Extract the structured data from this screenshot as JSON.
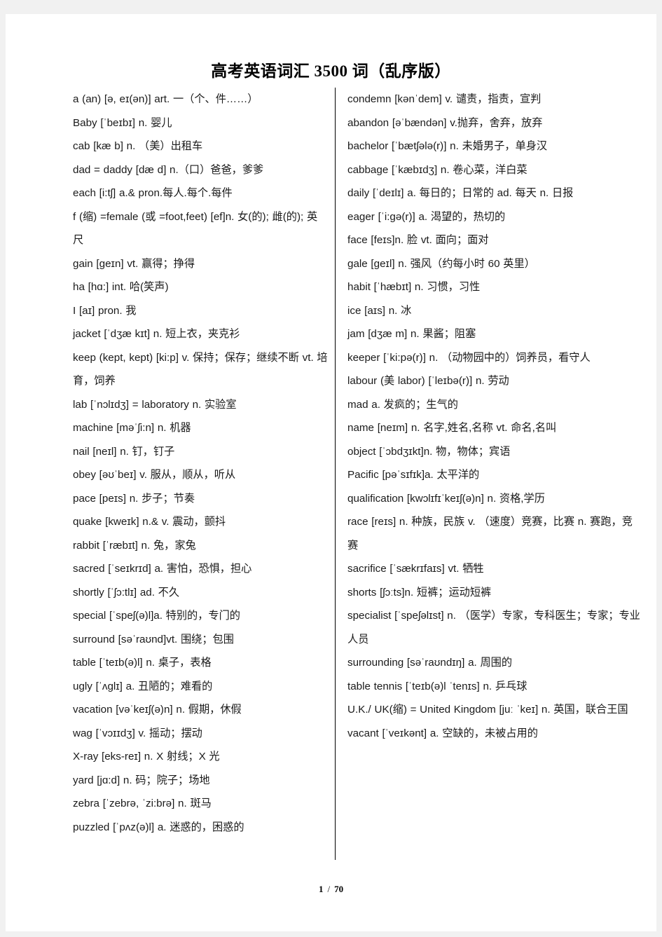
{
  "document": {
    "title": "高考英语词汇 3500 词（乱序版）"
  },
  "footer": {
    "current_page": "1",
    "separator": "/",
    "total_pages": "70"
  },
  "columns": {
    "left": [
      "a (an) [ə, eɪ(ən)] art.  一（个、件……）",
      "Baby [ˈbeɪbɪ] n.  婴儿",
      "cab [kæ b] n. （美）出租车",
      "dad = daddy [dæ d] n.（口）爸爸，爹爹",
      "each [i:tʃ] a.& pron.每人.每个.每件",
      "f (缩) =female (或 =foot,feet) [ef]n.  女(的); 雌(的);  英尺",
      "gain [geɪn] vt.  赢得；挣得",
      "ha [hɑ:] int.  哈(笑声)",
      "I [aɪ] pron.  我",
      "jacket [ˈdʒæ kɪt] n.  短上衣，夹克衫",
      "keep (kept, kept) [ki:p] v.  保持；保存；继续不断 vt.  培育，饲养",
      "lab [ˈnɔlɪdʒ] = laboratory n.  实验室",
      "machine [məˈʃi:n] n.  机器",
      "nail [neɪl] n.  钉，钉子",
      "obey [əʊˈbeɪ] v.  服从，顺从，听从",
      "pace [peɪs] n.  步子；节奏",
      "quake [kweɪk] n.& v.  震动，颤抖",
      "rabbit [ˈræbɪt] n.  兔，家兔",
      "sacred [ˈseɪkrɪd] a.  害怕，恐惧，担心",
      "shortly [ˈʃɔ:tlɪ] ad.  不久",
      "special [ˈspeʃ(ə)l]a.  特别的，专门的",
      "surround [səˈraʊnd]vt.  围绕；包围",
      "table [ˈteɪb(ə)l] n.  桌子，表格",
      "ugly [ˈʌglɪ]   a.  丑陋的；难看的",
      "vacation [vəˈkeɪʃ(ə)n] n.  假期，休假",
      "wag [ˈvɔɪɪdʒ] v.  摇动；摆动",
      "X-ray [eks-reɪ] n. X 射线；X 光",
      "yard [jɑ:d] n.  码；院子；场地",
      "zebra [ˈzebrə, ˈzi:brə] n.  斑马",
      "puzzled [ˈpʌz(ə)l] a.  迷惑的，困惑的"
    ],
    "right": [
      "condemn [kənˈdem] v.  谴责，指责，宣判",
      "abandon [əˈbændən]   v.抛弃，舍弃，放弃",
      "bachelor [ˈbætʃələ(r)] n.  未婚男子，单身汉",
      "cabbage [ˈkæbɪdʒ] n.  卷心菜，洋白菜",
      "daily [ˈdeɪlɪ] a.  每日的；日常的 ad.  每天 n.  日报",
      "eager [ˈi:gə(r)] a.  渴望的，热切的",
      "face [feɪs]n.  脸 vt.  面向；面对",
      "gale [geɪl] n.  强风（约每小时 60 英里）",
      "habit [ˈhæbɪt] n.  习惯，习性",
      "ice [aɪs] n.  冰",
      "jam [dʒæ m] n.  果酱；阻塞",
      "keeper [ˈki:pə(r)] n. （动物园中的）饲养员，看守人",
      "labour (美 labor) [ˈleɪbə(r)] n.  劳动",
      "mad a.  发疯的；生气的",
      "name [neɪm] n.  名字,姓名,名称 vt.  命名,名叫",
      "object [ˈɔbdʒɪkt]n.  物，物体；宾语",
      "Pacific [pəˈsɪfɪk]a.  太平洋的",
      "qualification [kwɔlɪfɪˈkeɪʃ(ə)n] n.  资格,学历",
      "race [reɪs] n.  种族，民族 v. （速度）竞赛，比赛 n.  赛跑，竞赛",
      "sacrifice [ˈsækrɪfaɪs] vt.  牺牲",
      "shorts [ʃɔːts]n.  短裤；运动短裤",
      "specialist [ˈspeʃəlɪst] n. （医学）专家，专科医生；专家；专业人员",
      "surrounding [səˈraʊndɪŋ] a.  周围的",
      "table tennis [ˈteɪb(ə)l ˈtenɪs] n.  乒乓球",
      "U.K./ UK(缩) = United Kingdom [juː ˈkeɪ] n.  英国，联合王国",
      "vacant [ˈveɪkənt] a.  空缺的，未被占用的"
    ]
  }
}
